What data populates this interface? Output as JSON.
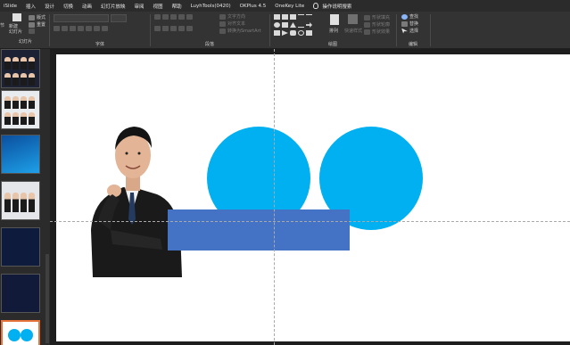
{
  "menu": {
    "tabs": [
      "iSlide",
      "插入",
      "设计",
      "切换",
      "动画",
      "幻灯片放映",
      "审阅",
      "视图",
      "帮助",
      "LuyhTools(0420)",
      "OKPlus 4.5",
      "OneKey Lite"
    ],
    "search_label": "操作说明搜索"
  },
  "ribbon": {
    "groups": [
      "字体",
      "段落",
      "绘图",
      "编辑"
    ],
    "slides_group_label": "幻灯片",
    "new_slide": "新建\n幻灯片",
    "layout": "版式",
    "reset": "重置",
    "section": "节",
    "arrange": "排列",
    "quick_styles": "快速样式",
    "text_direction": "文字方向",
    "align_text": "对齐文本",
    "convert_smartart": "转换为SmartArt",
    "shape_fill": "形状填充",
    "shape_outline": "形状轮廓",
    "shape_effects": "形状效果",
    "find": "查找",
    "replace": "替换",
    "select": "选择"
  },
  "colors": {
    "circle": "#00b0f0",
    "rectangle": "#4472c4",
    "selected_thumb_border": "#e8733a"
  }
}
